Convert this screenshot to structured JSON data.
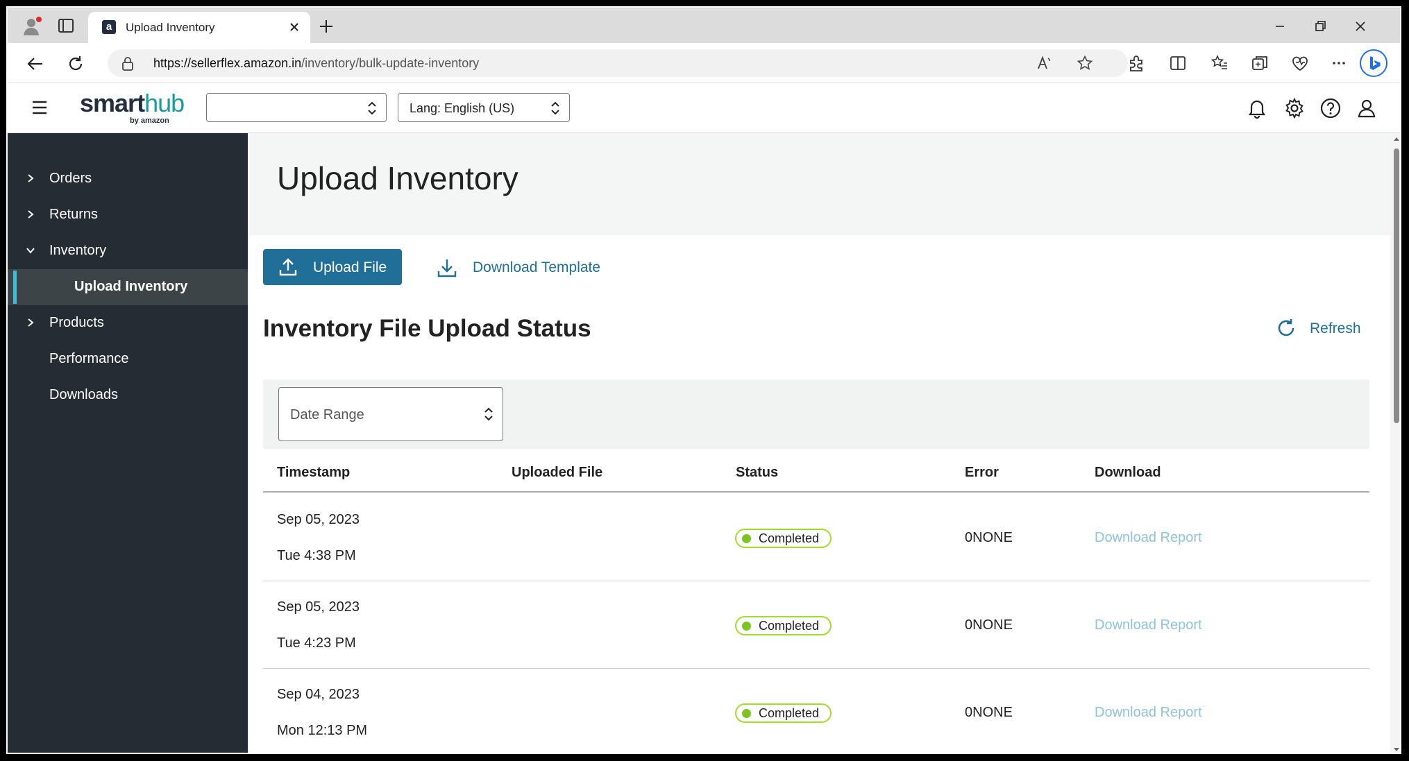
{
  "browser": {
    "tab_title": "Upload Inventory",
    "url_scheme_host": "https://sellerflex.amazon.in",
    "url_path": "/inventory/bulk-update-inventory"
  },
  "header": {
    "logo_main": "smart",
    "logo_accent": "hub",
    "logo_sub": "by amazon",
    "store_select_value": "",
    "lang_select_value": "Lang: English (US)"
  },
  "sidebar": {
    "items": [
      {
        "label": "Orders",
        "chevron": "chevron-right"
      },
      {
        "label": "Returns",
        "chevron": "chevron-right"
      },
      {
        "label": "Inventory",
        "chevron": "chevron-down"
      },
      {
        "label": "Upload Inventory",
        "chevron": "",
        "active": true
      },
      {
        "label": "Products",
        "chevron": "chevron-right"
      },
      {
        "label": "Performance",
        "chevron": ""
      },
      {
        "label": "Downloads",
        "chevron": ""
      }
    ]
  },
  "main": {
    "page_title": "Upload Inventory",
    "upload_button": "Upload File",
    "template_button": "Download Template",
    "section_title": "Inventory File Upload Status",
    "refresh_label": "Refresh",
    "date_range_placeholder": "Date Range",
    "table": {
      "columns": [
        "Timestamp",
        "Uploaded File",
        "Status",
        "Error",
        "Download"
      ],
      "rows": [
        {
          "date": "Sep 05, 2023",
          "time": "Tue 4:38 PM",
          "file": "",
          "status": "Completed",
          "error": "0NONE",
          "download": "Download Report"
        },
        {
          "date": "Sep 05, 2023",
          "time": "Tue 4:23 PM",
          "file": "",
          "status": "Completed",
          "error": "0NONE",
          "download": "Download Report"
        },
        {
          "date": "Sep 04, 2023",
          "time": "Mon 12:13 PM",
          "file": "",
          "status": "Completed",
          "error": "0NONE",
          "download": "Download Report"
        }
      ]
    }
  },
  "colors": {
    "accent": "#1f6f98",
    "sidebar_bg": "#262c33",
    "active_indicator": "#3fbbd6",
    "status_completed": "#7cc520",
    "disabled_link": "#8fc3da"
  }
}
